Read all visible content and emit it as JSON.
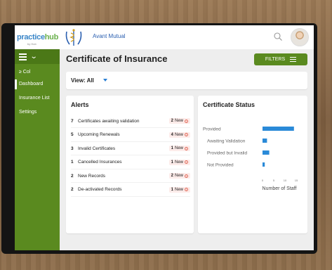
{
  "header": {
    "logo_primary": "practice",
    "logo_accent": "hub",
    "logo_sub": "by Hub",
    "org_name": "Avant Mutual"
  },
  "sidebar": {
    "items": [
      {
        "label": "≥ Col"
      },
      {
        "label": "Dashboard"
      },
      {
        "label": "Insurance List"
      },
      {
        "label": "Settings"
      }
    ]
  },
  "main": {
    "title": "Certificate of Insurance",
    "filters_label": "FILTERS",
    "view_label": "View: All"
  },
  "alerts": {
    "title": "Alerts",
    "rows": [
      {
        "count": "7",
        "label": "Certificates awaiting validation",
        "new_count": "2",
        "new_label": "New"
      },
      {
        "count": "5",
        "label": "Upcoming Renewals",
        "new_count": "4",
        "new_label": "New"
      },
      {
        "count": "3",
        "label": "Invalid Certificates",
        "new_count": "1",
        "new_label": "New"
      },
      {
        "count": "1",
        "label": "Cancelled Insurances",
        "new_count": "1",
        "new_label": "New"
      },
      {
        "count": "2",
        "label": "New Records",
        "new_count": "2",
        "new_label": "New"
      },
      {
        "count": "2",
        "label": "De-activated Records",
        "new_count": "1",
        "new_label": "New"
      }
    ]
  },
  "status": {
    "title": "Certificate Status"
  },
  "chart_data": {
    "type": "bar",
    "orientation": "horizontal",
    "title": "Certificate Status",
    "categories": [
      "Provided",
      "Awaiting Validation",
      "Provided but Invalid",
      "Not Provided"
    ],
    "values": [
      14,
      2,
      3,
      1
    ],
    "xlabel": "Number of Staff",
    "ylabel": "",
    "xlim": [
      0,
      15
    ],
    "xticks": [
      0,
      5,
      10,
      15
    ],
    "grid": false,
    "bar_color": "#2a8ad8"
  },
  "colors": {
    "brand_green": "#5a8a1f",
    "accent_blue": "#2a7fd4",
    "badge_bg": "#fdecea"
  }
}
